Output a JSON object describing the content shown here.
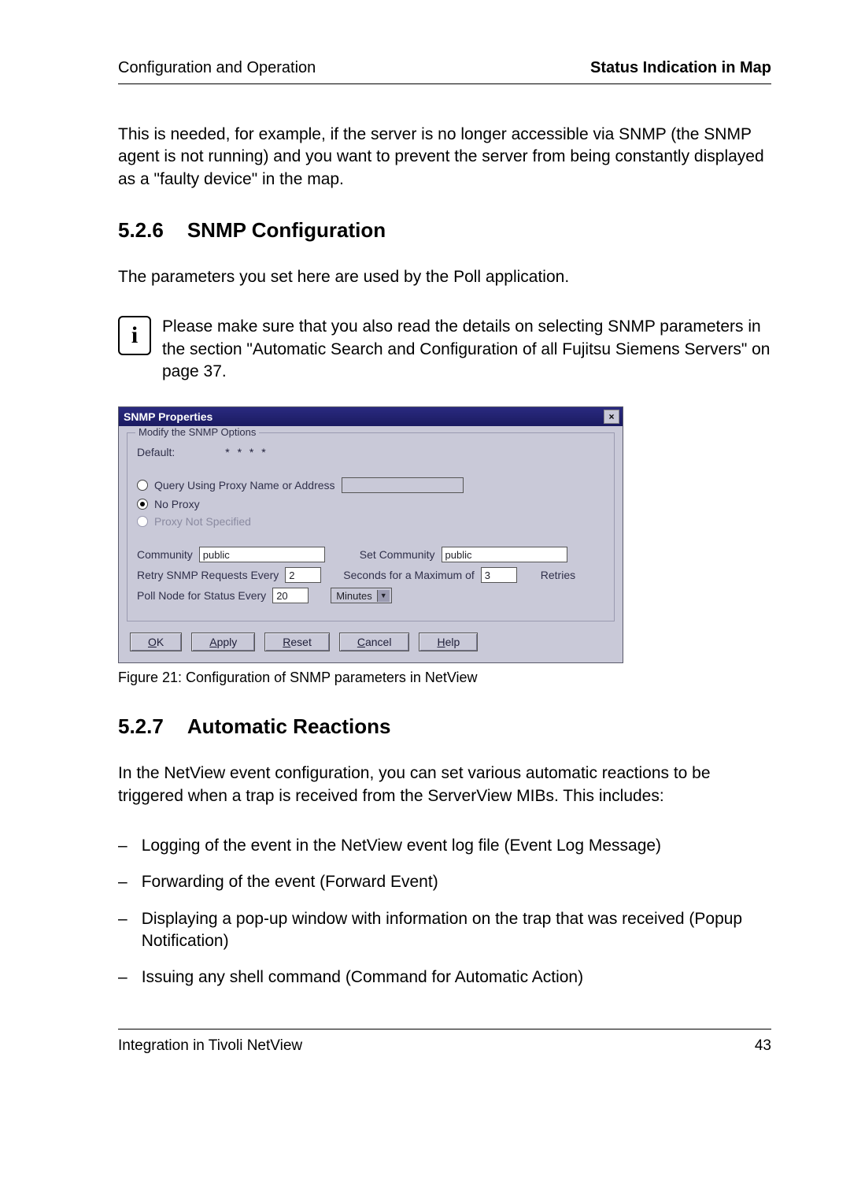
{
  "header": {
    "left": "Configuration and Operation",
    "right": "Status Indication in Map"
  },
  "intro": "This is needed, for example, if the server is no longer accessible via SNMP (the SNMP agent is not running) and you want to prevent the server from being constantly displayed as a \"faulty device\" in the map.",
  "sec526": {
    "num": "5.2.6",
    "title": "SNMP Configuration"
  },
  "sec526_p1": "The parameters you set here are used by the Poll application.",
  "note": "Please make sure that you also read the details on selecting SNMP parameters in the section \"Automatic Search and Configuration of all Fujitsu Siemens Servers\" on page 37.",
  "dialog": {
    "title": "SNMP Properties",
    "close": "×",
    "groupbox": "Modify the SNMP Options",
    "default_label": "Default:",
    "default_value": "* * * *",
    "radio1": "Query Using Proxy Name or Address",
    "radio1_value": "",
    "radio2": "No Proxy",
    "radio3": "Proxy Not Specified",
    "community_label": "Community",
    "community_value": "public",
    "setcommunity_label": "Set Community",
    "setcommunity_value": "public",
    "retry_label": "Retry SNMP Requests Every",
    "retry_value": "2",
    "seconds_label": "Seconds for a Maximum of",
    "seconds_value": "3",
    "retries_label": "Retries",
    "poll_label": "Poll Node for Status Every",
    "poll_value": "20",
    "poll_unit": "Minutes",
    "buttons": {
      "ok": "OK",
      "apply": "Apply",
      "reset": "Reset",
      "cancel": "Cancel",
      "help": "Help"
    }
  },
  "fig_caption": "Figure 21: Configuration of SNMP parameters in NetView",
  "sec527": {
    "num": "5.2.7",
    "title": "Automatic Reactions"
  },
  "sec527_p1": "In the NetView event configuration, you can set various automatic reactions to be triggered when a trap is received from the ServerView MIBs. This includes:",
  "bullets": [
    "Logging of the event in the NetView event log file (Event Log Message)",
    "Forwarding of the event (Forward Event)",
    "Displaying a pop-up window with information on the trap that was received (Popup Notification)",
    "Issuing any shell command (Command for Automatic Action)"
  ],
  "footer": {
    "left": "Integration in Tivoli NetView",
    "right": "43"
  }
}
